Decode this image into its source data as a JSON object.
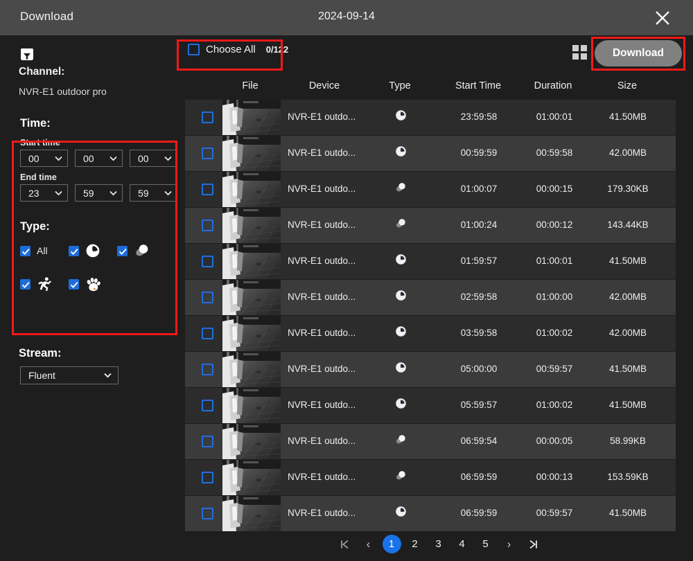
{
  "titlebar": {
    "title": "Download",
    "date": "2024-09-14",
    "close_icon": "close-icon"
  },
  "sidebar": {
    "filter_icon": "filter-folder-icon",
    "channel_label": "Channel:",
    "channel_value": "NVR-E1 outdoor pro",
    "time": {
      "heading": "Time:",
      "start_label": "Start time",
      "start_hour": "00",
      "start_minute": "00",
      "start_second": "00",
      "end_label": "End time",
      "end_hour": "23",
      "end_minute": "59",
      "end_second": "59"
    },
    "type": {
      "heading": "Type:",
      "options": [
        {
          "label": "All",
          "icon": "text-all",
          "checked": true
        },
        {
          "label": "",
          "icon": "clock-icon",
          "checked": true
        },
        {
          "label": "",
          "icon": "motion-sphere-icon",
          "checked": true
        },
        {
          "label": "",
          "icon": "running-person-icon",
          "checked": true
        },
        {
          "label": "",
          "icon": "paw-print-icon",
          "checked": true
        }
      ]
    },
    "stream": {
      "heading": "Stream:",
      "value": "Fluent"
    }
  },
  "toolbar": {
    "choose_all_label": "Choose All",
    "choose_all_count": "0/122",
    "choose_all_checked": false,
    "grid_icon": "grid-view-icon",
    "download_label": "Download"
  },
  "table": {
    "columns": [
      "File",
      "Device",
      "Type",
      "Start Time",
      "Duration",
      "Size"
    ],
    "rows": [
      {
        "device": "NVR-E1 outdo...",
        "type": "clock-icon",
        "start": "23:59:58",
        "duration": "01:00:01",
        "size": "41.50MB",
        "checked": false
      },
      {
        "device": "NVR-E1 outdo...",
        "type": "clock-icon",
        "start": "00:59:59",
        "duration": "00:59:58",
        "size": "42.00MB",
        "checked": false
      },
      {
        "device": "NVR-E1 outdo...",
        "type": "motion-sphere-icon",
        "start": "01:00:07",
        "duration": "00:00:15",
        "size": "179.30KB",
        "checked": false
      },
      {
        "device": "NVR-E1 outdo...",
        "type": "motion-sphere-icon",
        "start": "01:00:24",
        "duration": "00:00:12",
        "size": "143.44KB",
        "checked": false
      },
      {
        "device": "NVR-E1 outdo...",
        "type": "clock-icon",
        "start": "01:59:57",
        "duration": "01:00:01",
        "size": "41.50MB",
        "checked": false
      },
      {
        "device": "NVR-E1 outdo...",
        "type": "clock-icon",
        "start": "02:59:58",
        "duration": "01:00:00",
        "size": "42.00MB",
        "checked": false
      },
      {
        "device": "NVR-E1 outdo...",
        "type": "clock-icon",
        "start": "03:59:58",
        "duration": "01:00:02",
        "size": "42.00MB",
        "checked": false
      },
      {
        "device": "NVR-E1 outdo...",
        "type": "clock-icon",
        "start": "05:00:00",
        "duration": "00:59:57",
        "size": "41.50MB",
        "checked": false
      },
      {
        "device": "NVR-E1 outdo...",
        "type": "clock-icon",
        "start": "05:59:57",
        "duration": "01:00:02",
        "size": "41.50MB",
        "checked": false
      },
      {
        "device": "NVR-E1 outdo...",
        "type": "motion-sphere-icon",
        "start": "06:59:54",
        "duration": "00:00:05",
        "size": "58.99KB",
        "checked": false
      },
      {
        "device": "NVR-E1 outdo...",
        "type": "motion-sphere-icon",
        "start": "06:59:59",
        "duration": "00:00:13",
        "size": "153.59KB",
        "checked": false
      },
      {
        "device": "NVR-E1 outdo...",
        "type": "clock-icon",
        "start": "06:59:59",
        "duration": "00:59:57",
        "size": "41.50MB",
        "checked": false
      }
    ]
  },
  "pagination": {
    "first_icon": "first-page-icon",
    "prev_icon": "prev-page-icon",
    "pages": [
      "1",
      "2",
      "3",
      "4",
      "5"
    ],
    "current": "1",
    "next_icon": "next-page-icon",
    "last_icon": "last-page-icon"
  },
  "colors": {
    "accent": "#1a73e8",
    "annotation": "#f41919",
    "titlebar_bg": "#4a4a4a",
    "page_bg": "#1e1e1e",
    "row_bg": "#2c2c2c",
    "row_alt_bg": "#3b3b3b",
    "download_btn_bg": "#808080"
  }
}
